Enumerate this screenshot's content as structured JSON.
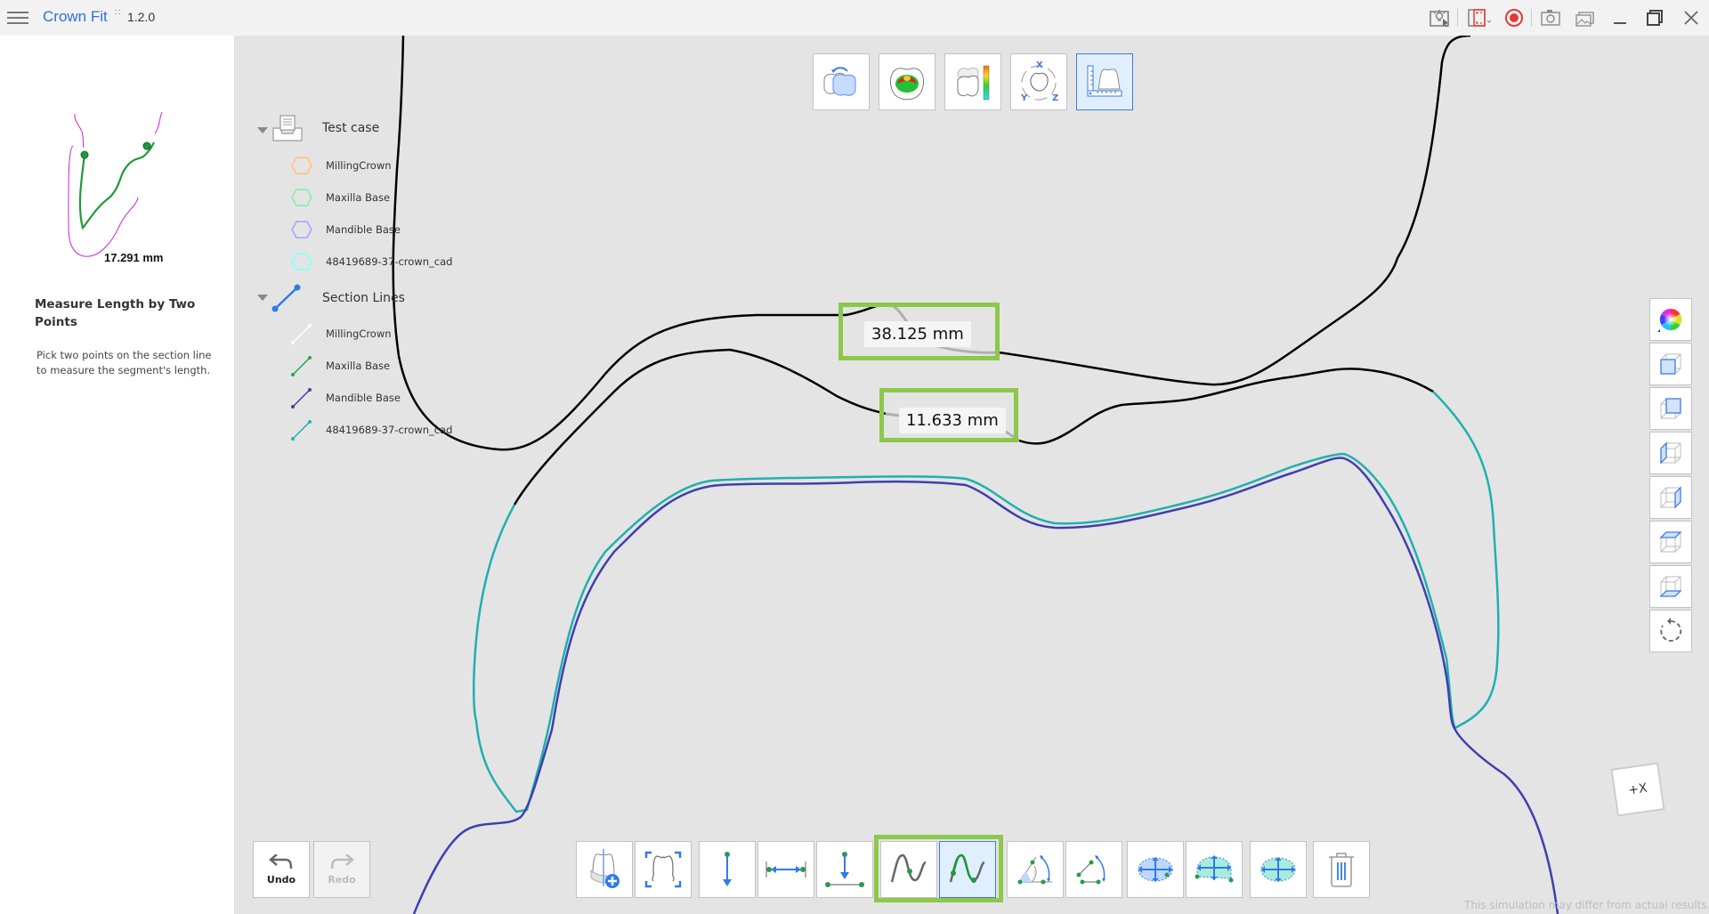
{
  "app": {
    "title": "Crown Fit",
    "badge": "∷",
    "version": "1.2.0"
  },
  "titlebar_icons": [
    {
      "name": "tips-icon"
    },
    {
      "name": "capture-region-icon"
    },
    {
      "name": "record-icon"
    },
    {
      "name": "screenshot-icon"
    },
    {
      "name": "gallery-icon"
    },
    {
      "name": "minimize-icon"
    },
    {
      "name": "restore-icon"
    },
    {
      "name": "close-icon"
    }
  ],
  "left_panel": {
    "preview_measurement": "17.291 mm",
    "tool_title": "Measure Length by Two Points",
    "tool_description": "Pick two points on the section line to measure the segment's length."
  },
  "tree": {
    "group1": {
      "label": "Test case",
      "items": [
        {
          "label": "MillingCrown",
          "color": "#ffc890"
        },
        {
          "label": "Maxilla Base",
          "color": "#90f0b0"
        },
        {
          "label": "Mandible Base",
          "color": "#b0b0ff"
        },
        {
          "label": "48419689-37-crown_cad",
          "color": "#90ffff"
        }
      ]
    },
    "group2": {
      "label": "Section Lines",
      "items": [
        {
          "label": "MillingCrown",
          "color": "#ffffff"
        },
        {
          "label": "Maxilla Base",
          "color": "#22aa44"
        },
        {
          "label": "Mandible Base",
          "color": "#4040b0"
        },
        {
          "label": "48419689-37-crown_cad",
          "color": "#20b0b0"
        }
      ]
    }
  },
  "top_tools": [
    {
      "name": "occlusion-adjust-tool",
      "active": false
    },
    {
      "name": "contact-map-tool",
      "active": false
    },
    {
      "name": "distance-color-map-tool",
      "active": false
    },
    {
      "name": "rotate-xyz-tool",
      "active": false
    },
    {
      "name": "section-measure-tool",
      "active": true
    }
  ],
  "measurements": [
    {
      "value": "38.125 mm"
    },
    {
      "value": "11.633 mm"
    }
  ],
  "side_tools": [
    {
      "name": "color-picker-view"
    },
    {
      "name": "front-view"
    },
    {
      "name": "back-view"
    },
    {
      "name": "left-view"
    },
    {
      "name": "right-view"
    },
    {
      "name": "top-view"
    },
    {
      "name": "bottom-view"
    },
    {
      "name": "reset-view"
    }
  ],
  "history": {
    "undo_label": "Undo",
    "redo_label": "Redo",
    "redo_enabled": false
  },
  "bottom_tools": [
    {
      "name": "add-section-tool"
    },
    {
      "name": "fit-section-tool"
    },
    {
      "name": "vertical-distance-tool"
    },
    {
      "name": "horizontal-distance-tool"
    },
    {
      "name": "perpendicular-distance-tool"
    },
    {
      "name": "curve-point-length-tool"
    },
    {
      "name": "two-point-length-tool",
      "active": true
    },
    {
      "name": "angle-protractor-tool"
    },
    {
      "name": "three-point-angle-tool"
    },
    {
      "name": "area-ellipse-tool"
    },
    {
      "name": "area-segment-tool"
    },
    {
      "name": "area-full-tool"
    },
    {
      "name": "delete-tool"
    }
  ],
  "nav_cube_label": "+X",
  "disclaimer": "This simulation may differ from actual results."
}
